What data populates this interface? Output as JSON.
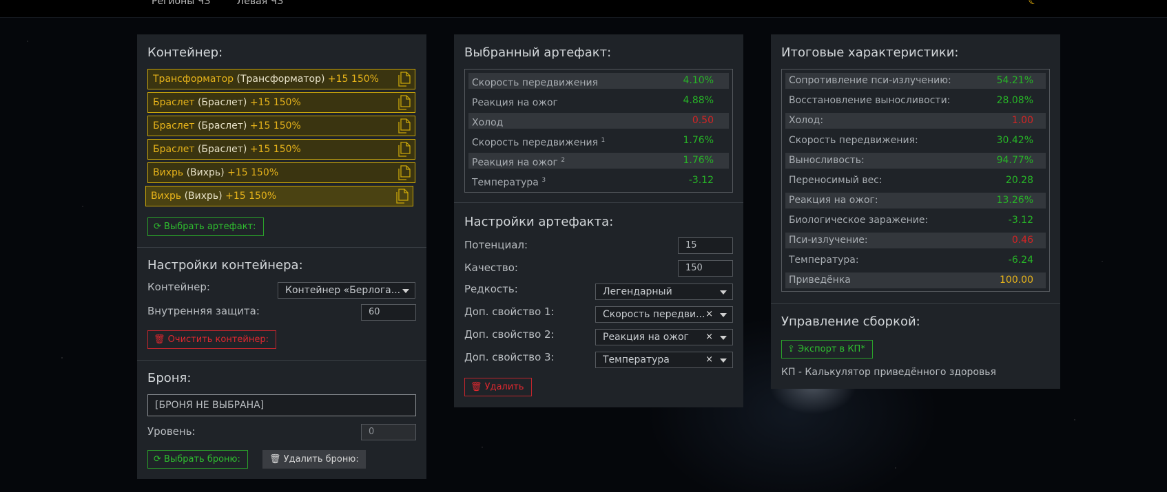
{
  "nav": [
    "Регионы ЧЗ",
    "Левая ЧЗ"
  ],
  "colors": {
    "accent": "#e8b41a",
    "green": "#27b427",
    "red": "#d42424",
    "panel": "#1f2328"
  },
  "container_panel": {
    "title": "Контейнер:",
    "artifacts": [
      {
        "name": "Трансформатор",
        "type": "(Трансформатор)",
        "stats": "+15 150%"
      },
      {
        "name": "Браслет",
        "type": "(Браслет)",
        "stats": "+15 150%"
      },
      {
        "name": "Браслет",
        "type": "(Браслет)",
        "stats": "+15 150%"
      },
      {
        "name": "Браслет",
        "type": "(Браслет)",
        "stats": "+15 150%"
      },
      {
        "name": "Вихрь",
        "type": "(Вихрь)",
        "stats": "+15 150%"
      },
      {
        "name": "Вихрь",
        "type": "(Вихрь)",
        "stats": "+15 150%"
      }
    ],
    "select_artifact_label": "Выбрать артефакт:",
    "settings_title": "Настройки контейнера:",
    "container_label": "Контейнер:",
    "container_value": "Контейнер «Берлога...",
    "inner_protection_label": "Внутренняя защита:",
    "inner_protection_value": "60",
    "clear_label": "Очистить контейнер:",
    "armor_title": "Броня:",
    "armor_value": "[БРОНЯ НЕ ВЫБРАНА]",
    "level_label": "Уровень:",
    "level_value": "0",
    "select_armor_label": "Выбрать броню:",
    "delete_armor_label": "Удалить броню:"
  },
  "artifact_panel": {
    "title": "Выбранный артефакт:",
    "stats": [
      {
        "name": "Скорость передвижения",
        "sup": "",
        "value": "4.10%",
        "color": "green"
      },
      {
        "name": "Реакция на ожог",
        "sup": "",
        "value": "4.88%",
        "color": "green"
      },
      {
        "name": "Холод",
        "sup": "",
        "value": "0.50",
        "color": "red"
      },
      {
        "name": "Скорость передвижения ",
        "sup": "1",
        "value": "1.76%",
        "color": "green"
      },
      {
        "name": "Реакция на ожог ",
        "sup": "2",
        "value": "1.76%",
        "color": "green"
      },
      {
        "name": "Температура ",
        "sup": "3",
        "value": "-3.12",
        "color": "green"
      }
    ],
    "settings_title": "Настройки артефакта:",
    "potential_label": "Потенциал:",
    "potential_value": "15",
    "quality_label": "Качество:",
    "quality_value": "150",
    "rarity_label": "Редкость:",
    "rarity_value": "Легендарный",
    "extra1_label": "Доп. свойство 1:",
    "extra1_value": "Скорость передви...",
    "extra2_label": "Доп. свойство 2:",
    "extra2_value": "Реакция на ожог",
    "extra3_label": "Доп. свойство 3:",
    "extra3_value": "Температура",
    "clear_symbol": "×",
    "delete_label": "Удалить"
  },
  "summary_panel": {
    "title": "Итоговые характеристики:",
    "stats": [
      {
        "name": "Сопротивление пси-излучению:",
        "value": "54.21%",
        "color": "green"
      },
      {
        "name": "Восстановление выносливости:",
        "value": "28.08%",
        "color": "green"
      },
      {
        "name": "Холод:",
        "value": "1.00",
        "color": "red"
      },
      {
        "name": "Скорость передвижения:",
        "value": "30.42%",
        "color": "green"
      },
      {
        "name": "Выносливость:",
        "value": "94.77%",
        "color": "green"
      },
      {
        "name": "Переносимый вес:",
        "value": "20.28",
        "color": "green"
      },
      {
        "name": "Реакция на ожог:",
        "value": "13.26%",
        "color": "green"
      },
      {
        "name": "Биологическое заражение:",
        "value": "-3.12",
        "color": "green"
      },
      {
        "name": "Пси-излучение:",
        "value": "0.46",
        "color": "red"
      },
      {
        "name": "Температура:",
        "value": "-6.24",
        "color": "green"
      },
      {
        "name": "Приведёнка",
        "value": "100.00",
        "color": "yellow"
      }
    ],
    "build_title": "Управление сборкой:",
    "export_label": "Экспорт в КП*",
    "footnote": "КП - Калькулятор приведённого здоровья"
  }
}
